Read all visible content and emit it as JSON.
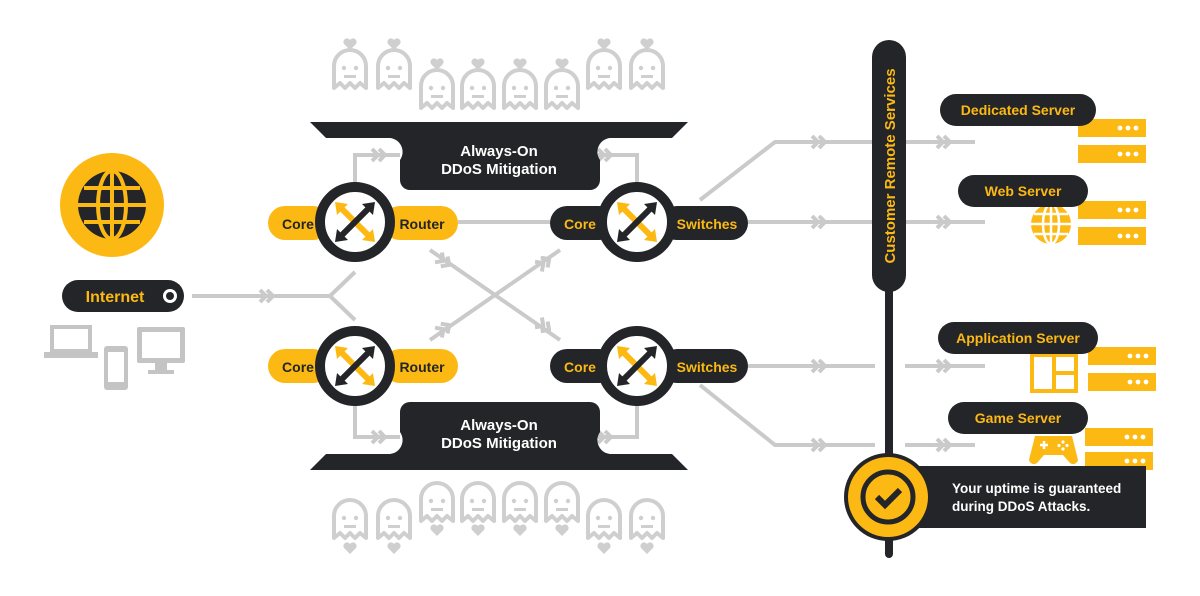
{
  "colors": {
    "accent": "#FDB913",
    "dark": "#232528",
    "line": "#CACACA",
    "ghost": "#CFCFCF"
  },
  "internet": {
    "label": "Internet",
    "icon": "globe-icon",
    "devices": [
      "laptop-icon",
      "phone-icon",
      "desktop-icon"
    ]
  },
  "mitigation": {
    "line1": "Always-On",
    "line2": "DDoS Mitigation"
  },
  "routers": [
    {
      "left": "Core",
      "right": "Router"
    },
    {
      "left": "Core",
      "right": "Router"
    }
  ],
  "switches": [
    {
      "left": "Core",
      "right": "Switches"
    },
    {
      "left": "Core",
      "right": "Switches"
    }
  ],
  "customer_bar": {
    "label": "Customer Remote Services"
  },
  "servers": [
    {
      "label": "Dedicated Server",
      "icon": "server-icon"
    },
    {
      "label": "Web Server",
      "icon": "globe-icon"
    },
    {
      "label": "Application Server",
      "icon": "app-window-icon"
    },
    {
      "label": "Game Server",
      "icon": "gamepad-icon"
    }
  ],
  "guarantee": {
    "line1": "Your uptime is guaranteed",
    "line2": "during DDoS Attacks.",
    "icon": "checkmark-icon"
  },
  "attackers": {
    "icon": "ghost-icon",
    "top_count": 8,
    "bottom_count": 8
  }
}
